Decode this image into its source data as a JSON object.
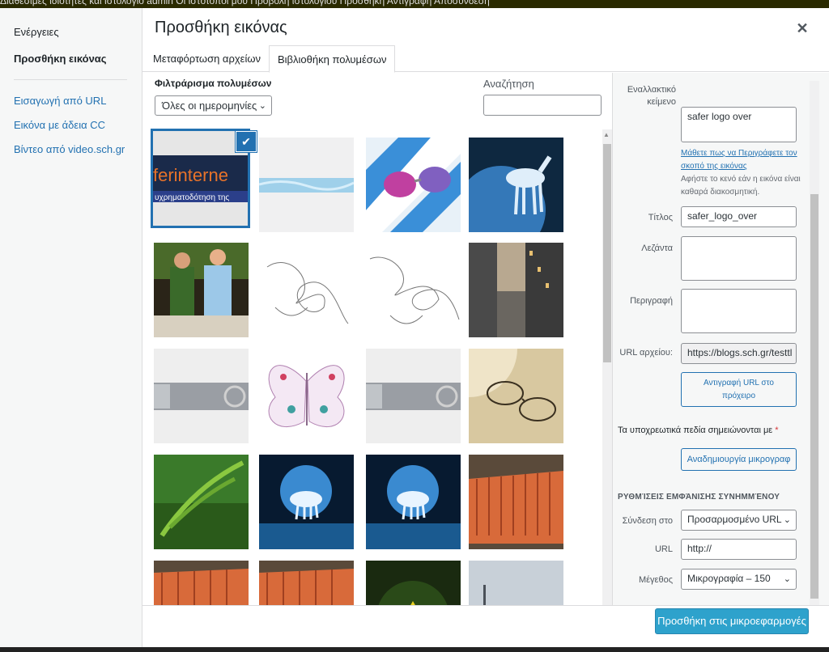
{
  "adminbar": {
    "text": "Διαθέσιμες ιδιότητες και ιστολόγιο   admin   Οι ιστότοποί μου   Προβολή ιστολογίου   Προσθήκη   Αντιγραφή   Αποσύνδεση"
  },
  "menu": {
    "actions_heading": "Ενέργειες",
    "active_item": "Προσθήκη εικόνας",
    "items": [
      "Εισαγωγή από URL",
      "Εικόνα με άδεια CC",
      "Βίντεο από video.sch.gr"
    ]
  },
  "frame": {
    "title": "Προσθήκη εικόνας",
    "close_icon": "close-icon"
  },
  "tabs": [
    "Μεταφόρτωση αρχείων",
    "Βιβλιοθήκη πολυμέσων"
  ],
  "toolbar": {
    "filter_label": "Φιλτράρισμα πολυμέσων",
    "date_filter": "Όλες οι ημερομηνίες",
    "search_label": "Αναζήτηση",
    "search_value": ""
  },
  "attachments": [
    {
      "name": "safer_logo_over",
      "selected": true,
      "logo_text": "ferinterne",
      "logo_sub": "υχρηματοδότηση της"
    },
    {
      "name": "blue-stripe"
    },
    {
      "name": "sunglasses"
    },
    {
      "name": "unicorn-blue"
    },
    {
      "name": "peter-pan"
    },
    {
      "name": "scribble-1"
    },
    {
      "name": "scribble-2"
    },
    {
      "name": "city-street"
    },
    {
      "name": "grey-banner-1"
    },
    {
      "name": "butterfly-drawing"
    },
    {
      "name": "grey-banner-2"
    },
    {
      "name": "glasses-on-paper"
    },
    {
      "name": "fern"
    },
    {
      "name": "unicorn-water-1"
    },
    {
      "name": "unicorn-water-2"
    },
    {
      "name": "carrots-1"
    },
    {
      "name": "carrots-2"
    },
    {
      "name": "carrots-3"
    },
    {
      "name": "triforce"
    },
    {
      "name": "foggy-sea"
    }
  ],
  "details": {
    "alt_label": "Εναλλακτικό κείμενο",
    "alt_value": "safer logo over",
    "alt_help_link": "Μάθετε πως να Περιγράφετε τον σκοπό της εικόνας",
    "alt_help_text": "Αφήστε το κενό εάν η εικόνα είναι καθαρά διακοσμητική.",
    "title_label": "Τίτλος",
    "title_value": "safer_logo_over",
    "caption_label": "Λεζάντα",
    "caption_value": "",
    "description_label": "Περιγραφή",
    "description_value": "",
    "url_label": "URL αρχείου:",
    "url_value": "https://blogs.sch.gr/testtl",
    "copy_url_button": "Αντιγραφή URL στο πρόχειρο",
    "required_note": "Τα υποχρεωτικά πεδία σημειώνονται με",
    "required_star": "*",
    "regenerate_button": "Αναδημιουργία μικρογραφ"
  },
  "display_settings": {
    "heading": "Ρυθμίσεις εμφάνισης συνημμένου",
    "link_label": "Σύνδεση στο",
    "link_value": "Προσαρμοσμένο URL",
    "url_label": "URL",
    "url_value": "http://",
    "size_label": "Μέγεθος",
    "size_value": "Μικρογραφία – 150"
  },
  "footer": {
    "insert_button": "Προσθήκη στις μικροεφαρμογές"
  },
  "colors": {
    "accent": "#2271b1",
    "primary_button": "#2ea2cc",
    "required": "#d63638"
  }
}
